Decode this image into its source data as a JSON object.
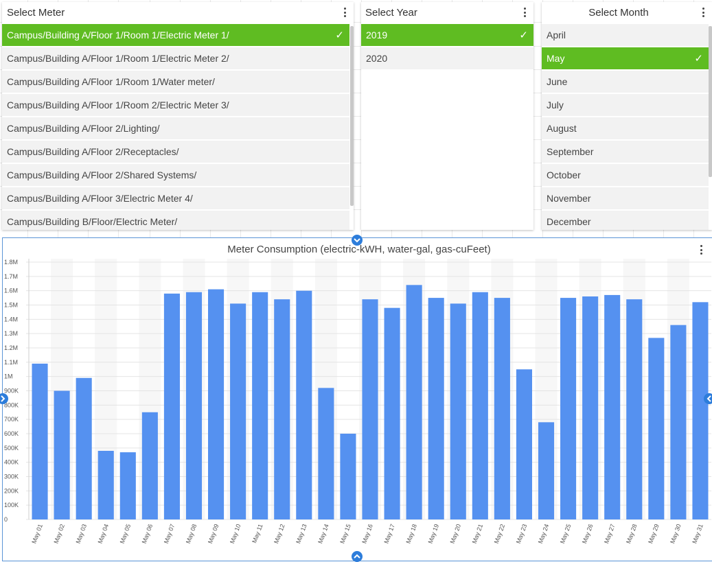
{
  "meter_panel": {
    "title": "Select Meter",
    "items": [
      {
        "label": "Campus/Building A/Floor 1/Room 1/Electric Meter 1/",
        "selected": true
      },
      {
        "label": "Campus/Building A/Floor 1/Room 1/Electric Meter 2/",
        "selected": false
      },
      {
        "label": "Campus/Building A/Floor 1/Room 1/Water meter/",
        "selected": false
      },
      {
        "label": "Campus/Building A/Floor 1/Room 2/Electric Meter 3/",
        "selected": false
      },
      {
        "label": "Campus/Building A/Floor 2/Lighting/",
        "selected": false
      },
      {
        "label": "Campus/Building A/Floor 2/Receptacles/",
        "selected": false
      },
      {
        "label": "Campus/Building A/Floor 2/Shared Systems/",
        "selected": false
      },
      {
        "label": "Campus/Building A/Floor 3/Electric Meter 4/",
        "selected": false
      },
      {
        "label": "Campus/Building B/Floor/Electric Meter/",
        "selected": false
      }
    ]
  },
  "year_panel": {
    "title": "Select Year",
    "items": [
      {
        "label": "2019",
        "selected": true
      },
      {
        "label": "2020",
        "selected": false
      }
    ]
  },
  "month_panel": {
    "title": "Select Month",
    "items": [
      {
        "label": "April",
        "selected": false
      },
      {
        "label": "May",
        "selected": true
      },
      {
        "label": "June",
        "selected": false
      },
      {
        "label": "July",
        "selected": false
      },
      {
        "label": "August",
        "selected": false
      },
      {
        "label": "September",
        "selected": false
      },
      {
        "label": "October",
        "selected": false
      },
      {
        "label": "November",
        "selected": false
      },
      {
        "label": "December",
        "selected": false
      }
    ]
  },
  "colors": {
    "selected": "#5fbc22",
    "bar": "#5591f0",
    "accent": "#2d7ddb"
  },
  "chart_data": {
    "type": "bar",
    "title": "Meter Consumption (electric-kWH, water-gal, gas-cuFeet)",
    "xlabel": "",
    "ylabel": "",
    "ylim": [
      0,
      1800000
    ],
    "y_ticks": [
      {
        "value": 0,
        "label": "0"
      },
      {
        "value": 100000,
        "label": "100K"
      },
      {
        "value": 200000,
        "label": "200K"
      },
      {
        "value": 300000,
        "label": "300K"
      },
      {
        "value": 400000,
        "label": "400K"
      },
      {
        "value": 500000,
        "label": "500K"
      },
      {
        "value": 600000,
        "label": "600K"
      },
      {
        "value": 700000,
        "label": "700K"
      },
      {
        "value": 800000,
        "label": "800K"
      },
      {
        "value": 900000,
        "label": "900K"
      },
      {
        "value": 1000000,
        "label": "1M"
      },
      {
        "value": 1100000,
        "label": "1.1M"
      },
      {
        "value": 1200000,
        "label": "1.2M"
      },
      {
        "value": 1300000,
        "label": "1.3M"
      },
      {
        "value": 1400000,
        "label": "1.4M"
      },
      {
        "value": 1500000,
        "label": "1.5M"
      },
      {
        "value": 1600000,
        "label": "1.6M"
      },
      {
        "value": 1700000,
        "label": "1.7M"
      },
      {
        "value": 1800000,
        "label": "1.8M"
      }
    ],
    "categories": [
      "May 01",
      "May 02",
      "May 03",
      "May 04",
      "May 05",
      "May 06",
      "May 07",
      "May 08",
      "May 09",
      "May 10",
      "May 11",
      "May 12",
      "May 13",
      "May 14",
      "May 15",
      "May 16",
      "May 17",
      "May 18",
      "May 19",
      "May 20",
      "May 21",
      "May 22",
      "May 23",
      "May 24",
      "May 25",
      "May 26",
      "May 27",
      "May 28",
      "May 29",
      "May 30",
      "May 31"
    ],
    "values": [
      1090000,
      900000,
      990000,
      480000,
      470000,
      750000,
      1580000,
      1590000,
      1610000,
      1510000,
      1590000,
      1540000,
      1600000,
      920000,
      600000,
      1540000,
      1480000,
      1640000,
      1550000,
      1510000,
      1590000,
      1550000,
      1050000,
      680000,
      1550000,
      1560000,
      1570000,
      1540000,
      1270000,
      1360000,
      1520000
    ],
    "grid": true
  }
}
